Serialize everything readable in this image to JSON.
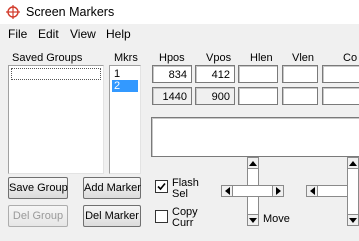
{
  "window": {
    "title": "Screen Markers"
  },
  "menu": {
    "file": "File",
    "edit": "Edit",
    "view": "View",
    "help": "Help"
  },
  "groups": {
    "header": "Saved Groups"
  },
  "markers": {
    "header": "Mkrs",
    "items": [
      "1",
      "2"
    ],
    "selected_index": 1
  },
  "position": {
    "headers": {
      "hpos": "Hpos",
      "vpos": "Vpos",
      "hlen": "Hlen",
      "vlen": "Vlen",
      "color": "Co"
    },
    "marker": {
      "hpos": "834",
      "vpos": "412",
      "hlen": "",
      "vlen": ""
    },
    "screen": {
      "hpos": "1440",
      "vpos": "900",
      "hlen": "",
      "vlen": ""
    }
  },
  "buttons": {
    "save_group": "Save Group",
    "del_group": "Del Group",
    "add_marker": "Add Marker",
    "del_marker": "Del Marker"
  },
  "options": {
    "flash_sel": {
      "line1": "Flash",
      "line2": "Sel",
      "checked": true
    },
    "copy_curr": {
      "line1": "Copy",
      "line2": "Curr",
      "checked": false
    }
  },
  "move": {
    "label": "Move"
  },
  "icons": {
    "app": "crosshair-icon"
  }
}
